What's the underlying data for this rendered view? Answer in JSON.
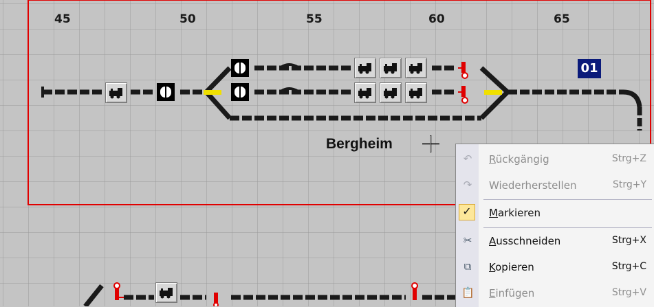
{
  "rulers": [
    "45",
    "50",
    "55",
    "60",
    "65"
  ],
  "station_label": "Bergheim",
  "block_badge": "01",
  "context_menu": {
    "items": [
      {
        "label": "Rückgängig",
        "shortcut": "Strg+Z",
        "icon": "undo-icon",
        "enabled": false
      },
      {
        "label": "Wiederherstellen",
        "shortcut": "Strg+Y",
        "icon": "redo-icon",
        "enabled": false
      },
      {
        "label": "Markieren",
        "shortcut": "",
        "icon": "check-icon",
        "enabled": true,
        "checked": true
      },
      {
        "label": "Ausschneiden",
        "shortcut": "Strg+X",
        "icon": "cut-icon",
        "enabled": true
      },
      {
        "label": "Kopieren",
        "shortcut": "Strg+C",
        "icon": "copy-icon",
        "enabled": true
      },
      {
        "label": "Einfügen",
        "shortcut": "Strg+V",
        "icon": "paste-icon",
        "enabled": false
      }
    ]
  },
  "colors": {
    "grid_background": "#c4c4c4",
    "grid_lines": "#9a9a9a",
    "selection_border": "#e00000",
    "track": "#1a1a1a",
    "turnout_highlight": "#f0e000",
    "signal": "#e00000",
    "badge": "#0a1a7a"
  }
}
